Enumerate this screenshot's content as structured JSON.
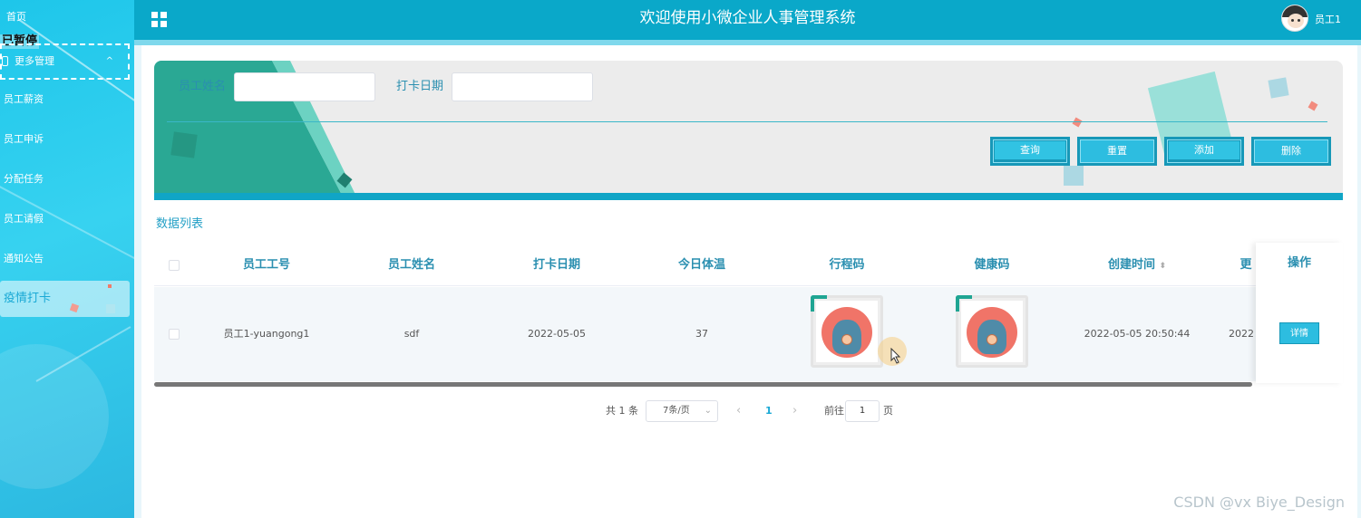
{
  "sidebar": {
    "home": "首页",
    "pause_label": "已暂停",
    "more_manage": "更多管理",
    "items": [
      {
        "label": "员工薪资"
      },
      {
        "label": "员工申诉"
      },
      {
        "label": "分配任务"
      },
      {
        "label": "员工请假"
      },
      {
        "label": "通知公告"
      }
    ],
    "active_item": "疫情打卡"
  },
  "header": {
    "title": "欢迎使用小微企业人事管理系统",
    "user_name": "员工1",
    "menu_icon": "grid-icon",
    "colors": {
      "header": "#0aa8c9",
      "sidebar": "#1ec6ea",
      "accent": "#2dbde0"
    }
  },
  "search": {
    "name_label": "员工姓名",
    "name_value": "",
    "date_label": "打卡日期",
    "date_value": "",
    "buttons": {
      "query": "查询",
      "reset": "重置",
      "add": "添加",
      "delete": "删除"
    }
  },
  "list": {
    "title": "数据列表",
    "columns": [
      "员工工号",
      "员工姓名",
      "打卡日期",
      "今日体温",
      "行程码",
      "健康码",
      "创建时间",
      "更",
      "操作"
    ],
    "sort_icon": "sort-caret-icon",
    "rows": [
      {
        "employee_id": "员工1-yuangong1",
        "employee_name": "sdf",
        "checkin_date": "2022-05-05",
        "temperature": "37",
        "created_at": "2022-05-05 20:50:44",
        "updated_at": "2022",
        "action": "详情"
      }
    ]
  },
  "pagination": {
    "total": "共 1 条",
    "page_size": "7条/页",
    "current_page": "1",
    "goto_label": "前往",
    "goto_value": "1",
    "page_suffix": "页"
  },
  "watermark": "CSDN @vx  Biye_Design"
}
